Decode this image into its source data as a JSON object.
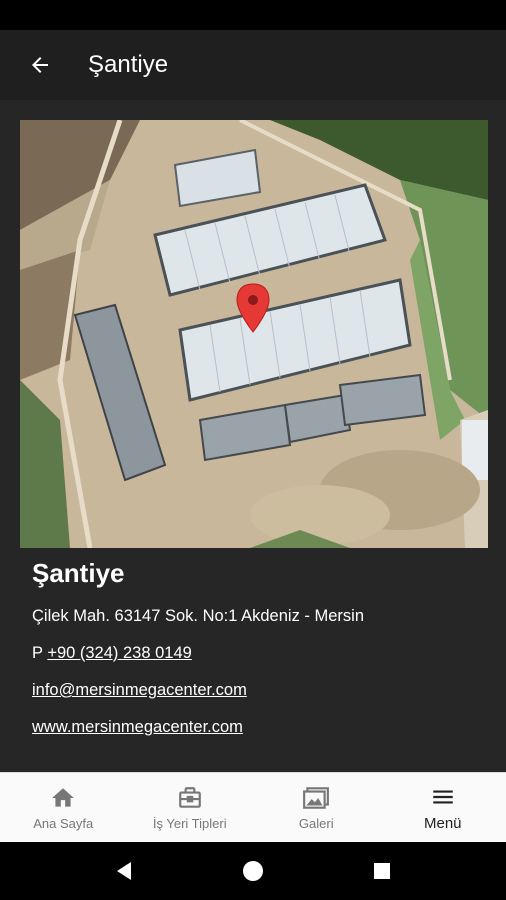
{
  "app_bar": {
    "title": "Şantiye",
    "back_icon": "arrow-back-icon"
  },
  "place": {
    "title": "Şantiye",
    "address": "Çilek Mah. 63147 Sok. No:1 Akdeniz - Mersin",
    "phone_prefix": "P",
    "phone": "+90 (324) 238 0149",
    "email": "info@mersinmegacenter.com",
    "website": "www.mersinmegacenter.com"
  },
  "map": {
    "marker_icon": "map-pin-icon",
    "marker_color": "#e53935"
  },
  "bottom_nav": {
    "items": [
      {
        "label": "Ana Sayfa",
        "icon": "home-icon"
      },
      {
        "label": "İş Yeri Tipleri",
        "icon": "inbox-icon"
      },
      {
        "label": "Galeri",
        "icon": "gallery-icon"
      },
      {
        "label": "Menü",
        "icon": "menu-icon"
      }
    ]
  },
  "colors": {
    "background": "#262626",
    "app_bar": "#1f1f1f",
    "nav_bar": "#fafafa"
  }
}
